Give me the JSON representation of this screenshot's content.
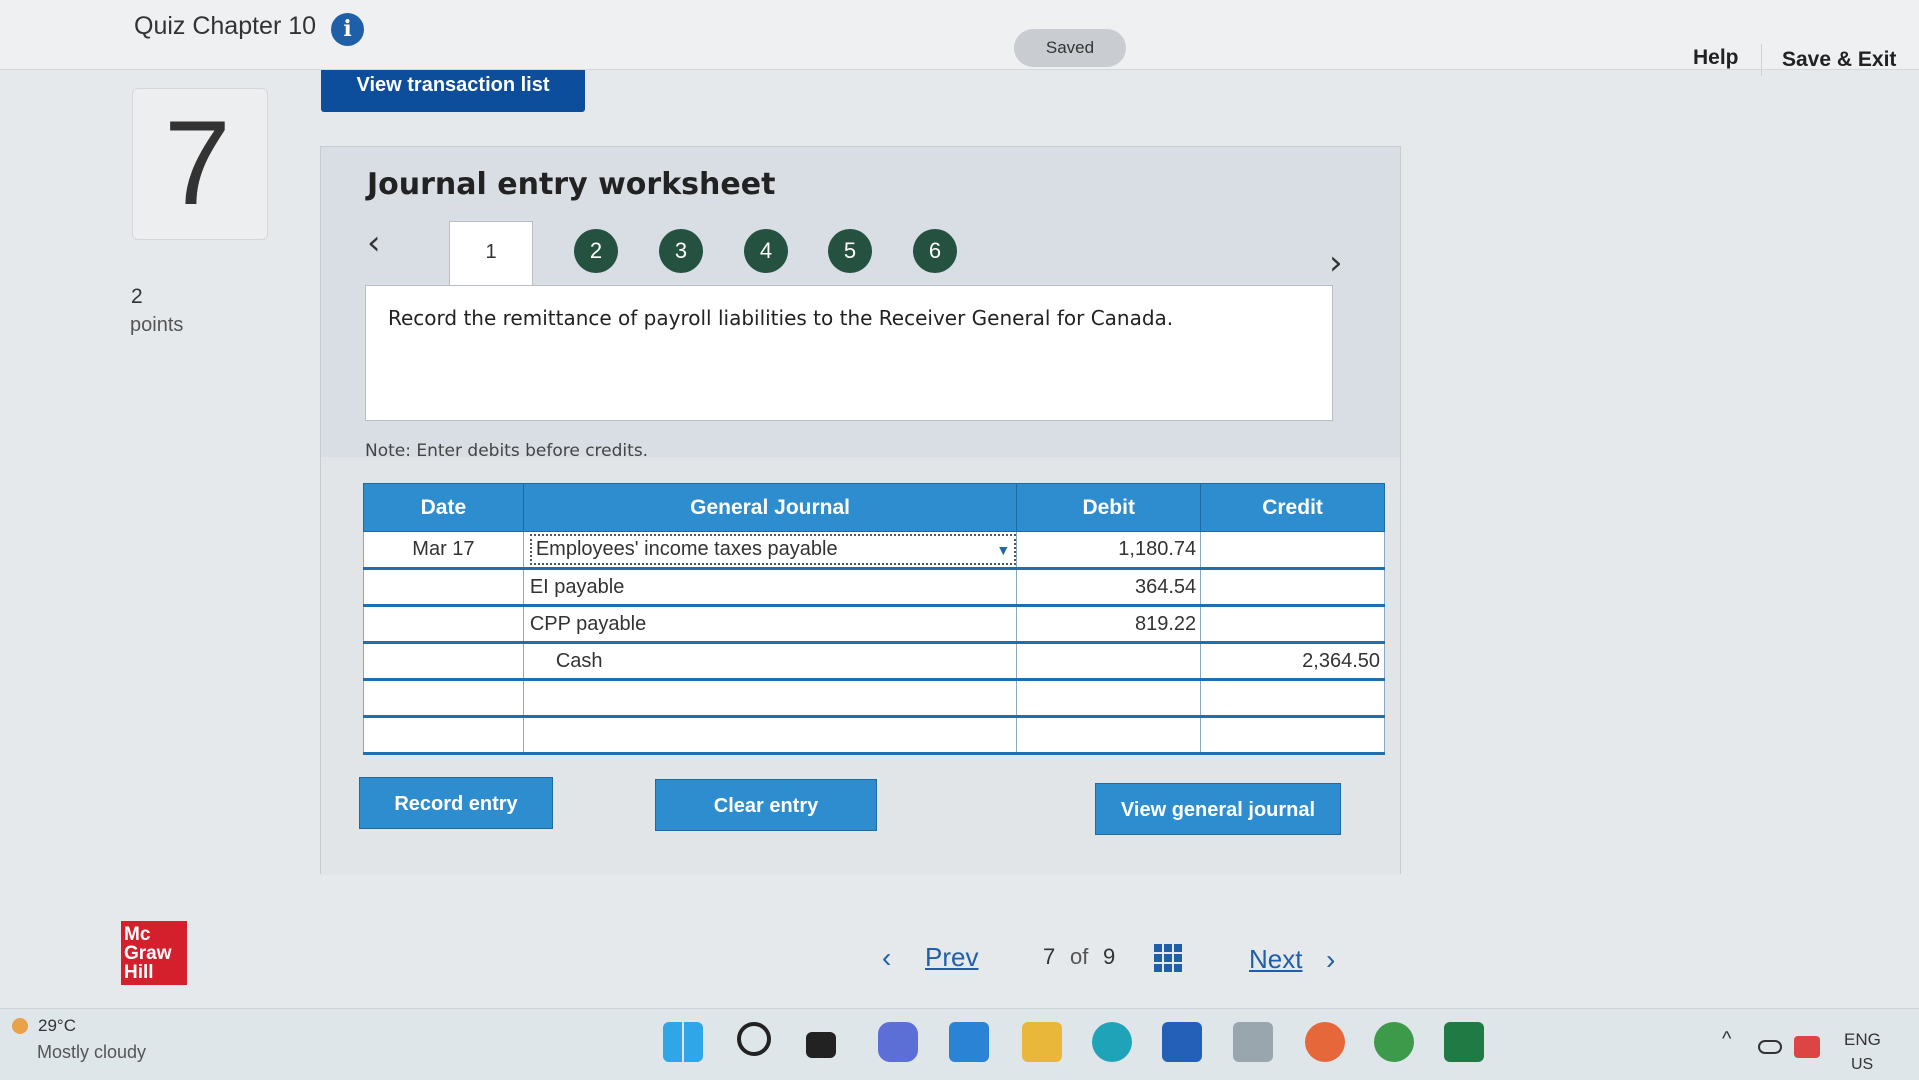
{
  "header": {
    "quiz_title": "Quiz Chapter 10",
    "saved_label": "Saved",
    "help_label": "Help",
    "save_exit_label": "Save & Exit"
  },
  "question": {
    "number": "7",
    "points_value": "2",
    "points_label": "points"
  },
  "view_transaction_label": "View transaction list",
  "worksheet": {
    "title": "Journal entry worksheet",
    "tabs": [
      "1",
      "2",
      "3",
      "4",
      "5",
      "6"
    ],
    "instruction": "Record the remittance of payroll liabilities to the Receiver General for Canada.",
    "note": "Note: Enter debits before credits."
  },
  "journal": {
    "headers": {
      "date": "Date",
      "general_journal": "General Journal",
      "debit": "Debit",
      "credit": "Credit"
    },
    "rows": [
      {
        "date": "Mar 17",
        "account": "Employees' income taxes payable",
        "debit": "1,180.74",
        "credit": ""
      },
      {
        "date": "",
        "account": "EI payable",
        "debit": "364.54",
        "credit": ""
      },
      {
        "date": "",
        "account": "CPP payable",
        "debit": "819.22",
        "credit": ""
      },
      {
        "date": "",
        "account": "Cash",
        "debit": "",
        "credit": "2,364.50"
      },
      {
        "date": "",
        "account": "",
        "debit": "",
        "credit": ""
      },
      {
        "date": "",
        "account": "",
        "debit": "",
        "credit": ""
      }
    ]
  },
  "buttons": {
    "record_entry": "Record entry",
    "clear_entry": "Clear entry",
    "view_general_journal": "View general journal"
  },
  "pagination": {
    "prev_label": "Prev",
    "current": "7",
    "of_label": "of",
    "total": "9",
    "next_label": "Next"
  },
  "logo_text": "Mc Graw Hill",
  "taskbar": {
    "temperature": "29°C",
    "condition": "Mostly cloudy",
    "language": "ENG",
    "region": "US"
  }
}
